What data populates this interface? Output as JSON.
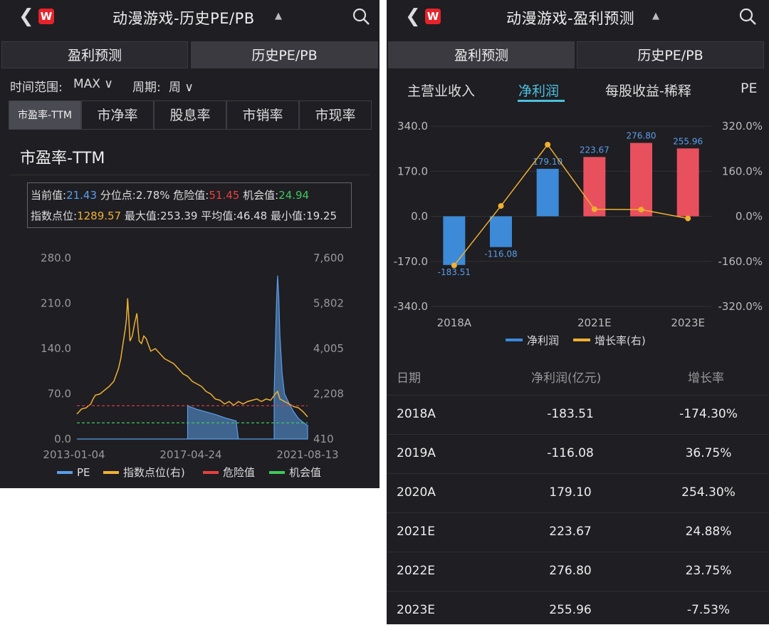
{
  "left": {
    "title": "动漫游戏-历史PE/PB",
    "seg_tabs": [
      "盈利预测",
      "历史PE/PB"
    ],
    "filters": {
      "range_label": "时间范围:",
      "range_value": "MAX",
      "period_label": "周期:",
      "period_value": "周"
    },
    "metric_tabs": [
      "市盈率-TTM",
      "市净率",
      "股息率",
      "市销率",
      "市现率"
    ],
    "section_title": "市盈率-TTM",
    "stats": {
      "current_label": "当前值:",
      "current": "21.43",
      "pct_label": "分位点:",
      "pct": "2.78%",
      "danger_label": "危险值:",
      "danger": "51.45",
      "chance_label": "机会值:",
      "chance": "24.94",
      "index_label": "指数点位:",
      "index": "1289.57",
      "max_label": "最大值:",
      "max": "253.39",
      "avg_label": "平均值:",
      "avg": "46.48",
      "min_label": "最小值:",
      "min": "19.25"
    },
    "chart_data": {
      "type": "area",
      "x_ticks": [
        "2013-01-04",
        "2017-04-24",
        "2021-08-13"
      ],
      "y_left_ticks": [
        "280.0",
        "210.0",
        "140.0",
        "70.0",
        "0.0"
      ],
      "y_right_ticks": [
        "7,600",
        "5,802",
        "4,005",
        "2,208",
        "410"
      ],
      "ylim_left": [
        0,
        280
      ],
      "ylim_right": [
        410,
        7600
      ],
      "danger_line": 51.45,
      "chance_line": 24.94,
      "pe_series": [
        [
          0,
          0
        ],
        [
          0.15,
          0
        ],
        [
          0.48,
          0
        ],
        [
          0.48,
          52
        ],
        [
          0.49,
          50
        ],
        [
          0.52,
          46
        ],
        [
          0.56,
          42
        ],
        [
          0.6,
          38
        ],
        [
          0.64,
          33
        ],
        [
          0.67,
          30
        ],
        [
          0.69,
          28
        ],
        [
          0.7,
          0
        ],
        [
          0.855,
          0
        ],
        [
          0.855,
          72
        ],
        [
          0.86,
          140
        ],
        [
          0.865,
          210
        ],
        [
          0.87,
          253
        ],
        [
          0.875,
          220
        ],
        [
          0.88,
          160
        ],
        [
          0.89,
          100
        ],
        [
          0.9,
          70
        ],
        [
          0.92,
          55
        ],
        [
          0.94,
          42
        ],
        [
          0.96,
          32
        ],
        [
          0.98,
          26
        ],
        [
          1,
          21
        ]
      ],
      "index_series": [
        [
          0,
          1400
        ],
        [
          0.02,
          1600
        ],
        [
          0.04,
          1650
        ],
        [
          0.06,
          1800
        ],
        [
          0.07,
          2000
        ],
        [
          0.08,
          2150
        ],
        [
          0.1,
          2200
        ],
        [
          0.12,
          2350
        ],
        [
          0.14,
          2500
        ],
        [
          0.16,
          2700
        ],
        [
          0.18,
          3200
        ],
        [
          0.19,
          3600
        ],
        [
          0.2,
          4200
        ],
        [
          0.21,
          4800
        ],
        [
          0.215,
          5200
        ],
        [
          0.22,
          6000
        ],
        [
          0.225,
          5200
        ],
        [
          0.23,
          4300
        ],
        [
          0.24,
          4500
        ],
        [
          0.25,
          5000
        ],
        [
          0.26,
          5400
        ],
        [
          0.265,
          4800
        ],
        [
          0.27,
          4300
        ],
        [
          0.28,
          4200
        ],
        [
          0.29,
          4500
        ],
        [
          0.3,
          4400
        ],
        [
          0.32,
          3900
        ],
        [
          0.34,
          4000
        ],
        [
          0.36,
          3800
        ],
        [
          0.38,
          3600
        ],
        [
          0.4,
          3500
        ],
        [
          0.42,
          3400
        ],
        [
          0.44,
          3200
        ],
        [
          0.46,
          3000
        ],
        [
          0.48,
          2900
        ],
        [
          0.5,
          2700
        ],
        [
          0.52,
          2600
        ],
        [
          0.54,
          2500
        ],
        [
          0.56,
          2300
        ],
        [
          0.58,
          2200
        ],
        [
          0.6,
          2000
        ],
        [
          0.62,
          1950
        ],
        [
          0.64,
          1800
        ],
        [
          0.66,
          1900
        ],
        [
          0.68,
          1750
        ],
        [
          0.7,
          1900
        ],
        [
          0.72,
          1800
        ],
        [
          0.74,
          1900
        ],
        [
          0.76,
          1950
        ],
        [
          0.78,
          2000
        ],
        [
          0.8,
          1900
        ],
        [
          0.82,
          2000
        ],
        [
          0.84,
          1950
        ],
        [
          0.86,
          2200
        ],
        [
          0.87,
          2300
        ],
        [
          0.88,
          2000
        ],
        [
          0.9,
          1900
        ],
        [
          0.92,
          1800
        ],
        [
          0.94,
          1700
        ],
        [
          0.96,
          1650
        ],
        [
          0.98,
          1500
        ],
        [
          1,
          1290
        ]
      ],
      "legend": [
        "PE",
        "指数点位(右)",
        "危险值",
        "机会值"
      ],
      "colors": {
        "pe": "#5b9ee8",
        "index": "#f0b030",
        "danger": "#e84040",
        "chance": "#3ec85a"
      }
    }
  },
  "right": {
    "title": "动漫游戏-盈利预测",
    "seg_tabs": [
      "盈利预测",
      "历史PE/PB"
    ],
    "sub_tabs": [
      "主营业收入",
      "净利润",
      "每股收益-稀释",
      "PE"
    ],
    "chart_data": {
      "type": "bar",
      "categories": [
        "2018A",
        "2019A",
        "2020A",
        "2021E",
        "2022E",
        "2023E"
      ],
      "x_tick_labels": [
        "2018A",
        "2021E",
        "2023E"
      ],
      "series": [
        {
          "name": "净利润",
          "values": [
            -183.51,
            -116.08,
            179.1,
            223.67,
            276.8,
            255.96
          ],
          "value_labels": [
            "-183.51",
            "-116.08",
            "179.10",
            "223.67",
            "276.80",
            "255.96"
          ]
        },
        {
          "name": "增长率(右)",
          "values": [
            -174.3,
            36.75,
            254.3,
            24.88,
            23.75,
            -7.53
          ]
        }
      ],
      "y_left_ticks": [
        "340.0",
        "170.0",
        "0.0",
        "-170.0",
        "-340.0"
      ],
      "y_right_ticks": [
        "320.0%",
        "160.0%",
        "0.0%",
        "-160.0%",
        "-320.0%"
      ],
      "ylim_left": [
        -340,
        340
      ],
      "ylim_right": [
        -320,
        320
      ],
      "colors": {
        "actual": "#3c8ad8",
        "estimate": "#e8505e",
        "growth": "#f0b030"
      }
    },
    "table": {
      "headers": [
        "日期",
        "净利润(亿元)",
        "增长率"
      ],
      "rows": [
        [
          "2018A",
          "-183.51",
          "-174.30%"
        ],
        [
          "2019A",
          "-116.08",
          "36.75%"
        ],
        [
          "2020A",
          "179.10",
          "254.30%"
        ],
        [
          "2021E",
          "223.67",
          "24.88%"
        ],
        [
          "2022E",
          "276.80",
          "23.75%"
        ],
        [
          "2023E",
          "255.96",
          "-7.53%"
        ]
      ]
    }
  }
}
